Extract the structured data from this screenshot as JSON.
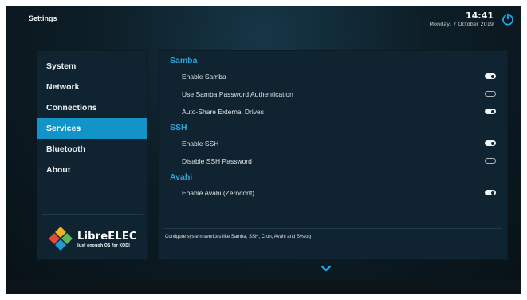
{
  "header": {
    "title": "Settings",
    "time": "14:41",
    "date": "Monday, 7 October 2019"
  },
  "sidebar": {
    "items": [
      {
        "label": "System"
      },
      {
        "label": "Network"
      },
      {
        "label": "Connections"
      },
      {
        "label": "Services",
        "active": true
      },
      {
        "label": "Bluetooth"
      },
      {
        "label": "About"
      }
    ],
    "logo": {
      "name": "LibreELEC",
      "tagline": "Just enough OS for KODI"
    }
  },
  "content": {
    "sections": [
      {
        "title": "Samba",
        "rows": [
          {
            "label": "Enable Samba",
            "enabled": true
          },
          {
            "label": "Use Samba Password Authentication",
            "enabled": false
          },
          {
            "label": "Auto-Share External Drives",
            "enabled": true
          }
        ]
      },
      {
        "title": "SSH",
        "rows": [
          {
            "label": "Enable SSH",
            "enabled": true
          },
          {
            "label": "Disable SSH Password",
            "enabled": false
          }
        ]
      },
      {
        "title": "Avahi",
        "rows": [
          {
            "label": "Enable Avahi (Zeroconf)",
            "enabled": true
          }
        ]
      }
    ],
    "description": "Configure system services like Samba, SSH, Cron, Avahi and Syslog"
  },
  "colors": {
    "accent": "#1294c8",
    "section_title": "#2aa4dc",
    "panel": "#0f2430"
  },
  "icons": {
    "power": "power-icon",
    "scroll_down": "chevron-down-icon"
  }
}
